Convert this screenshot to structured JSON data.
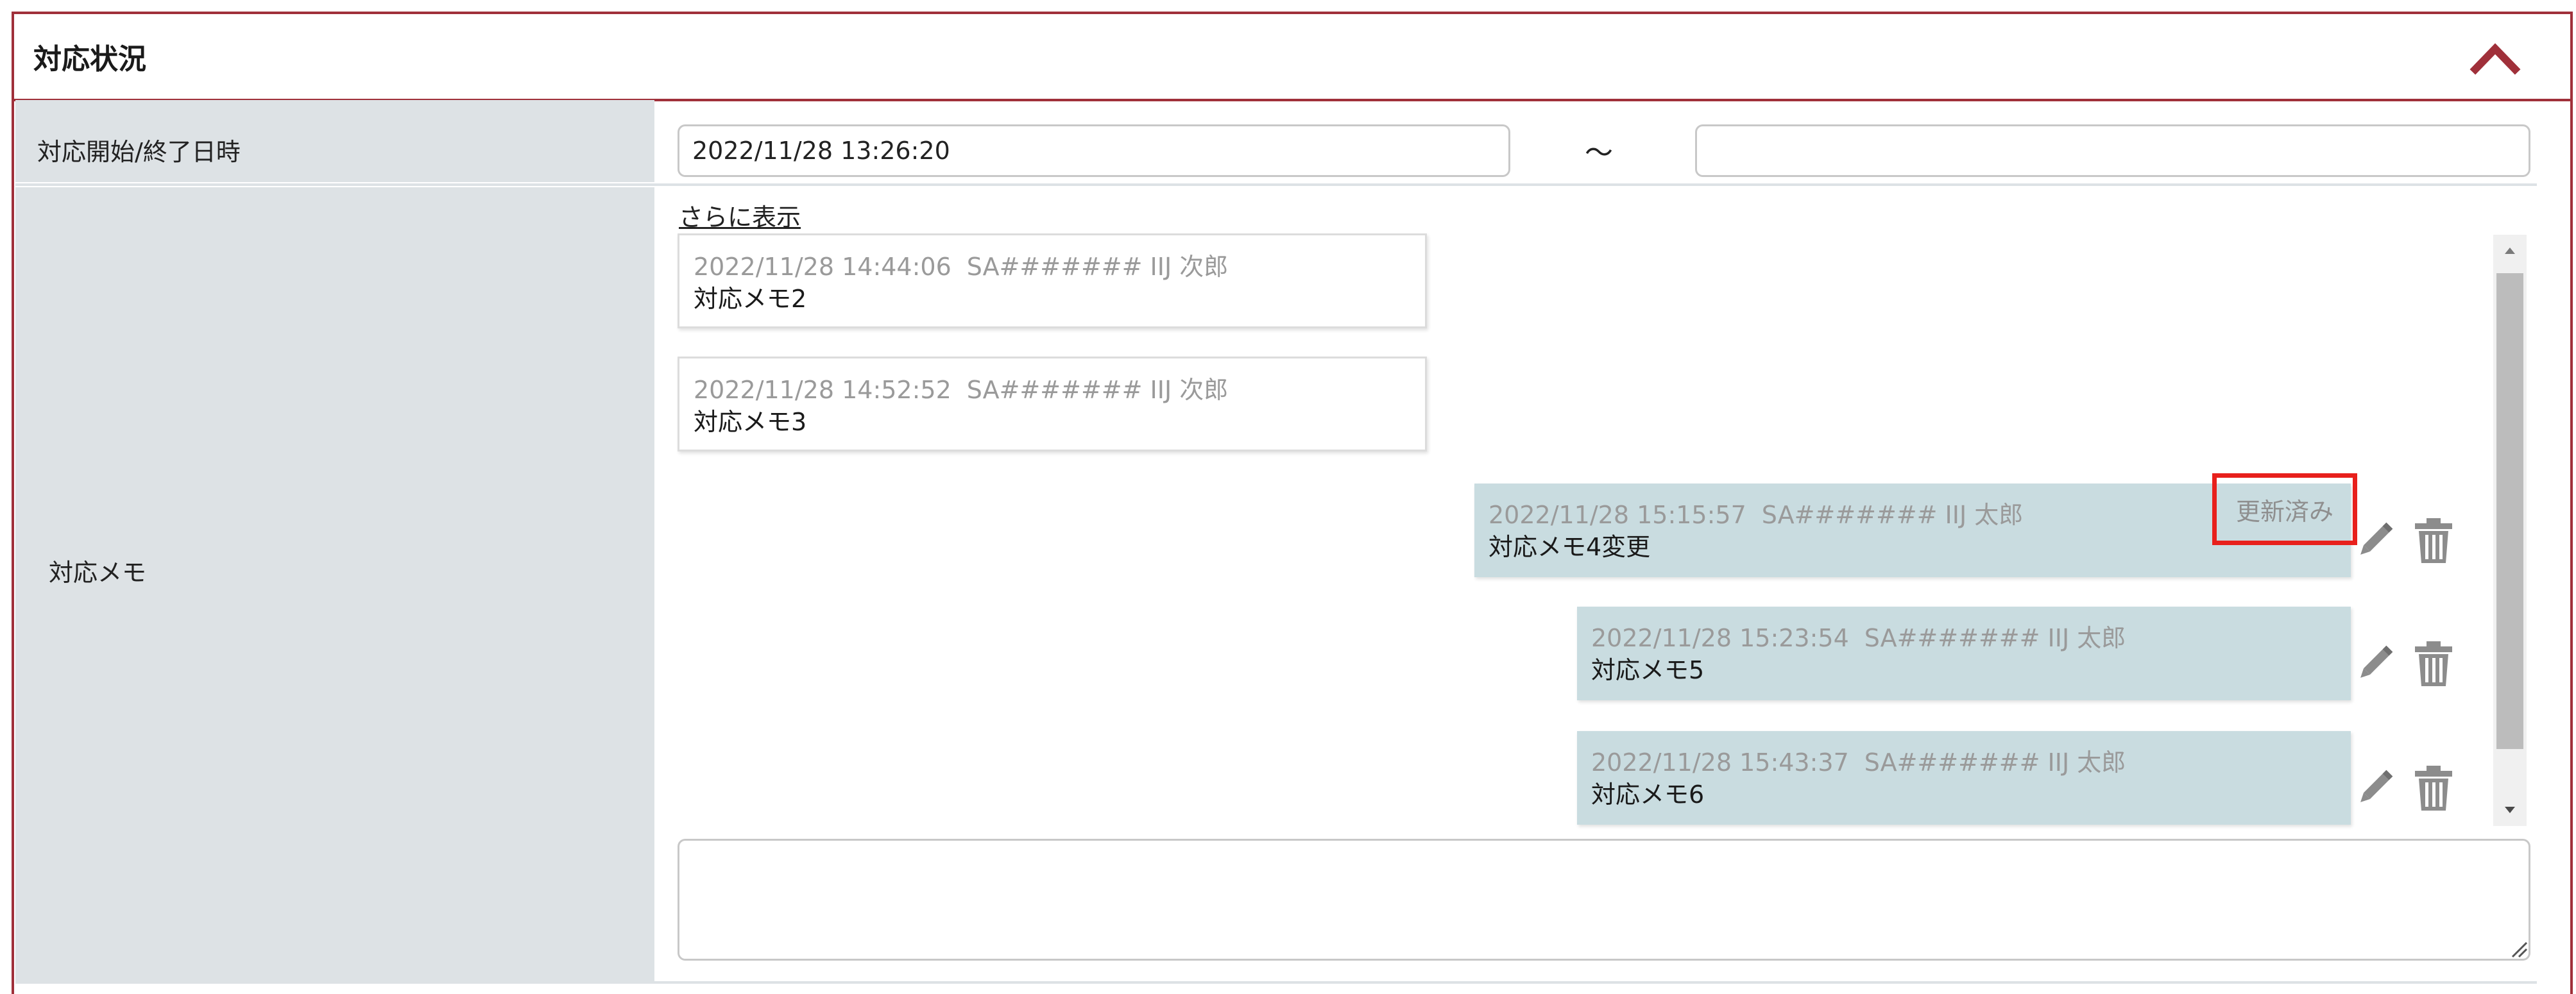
{
  "panel": {
    "title": "対応状況",
    "colors": {
      "border": "#a0303a",
      "label_bg": "#dde2e5",
      "mine_bg": "#c9dce0",
      "highlight": "#e8201c"
    }
  },
  "period": {
    "label": "対応開始/終了日時",
    "start_value": "2022/11/28 13:26:20",
    "separator": "～",
    "end_value": ""
  },
  "memo_section": {
    "label": "対応メモ",
    "more_link": "さらに表示",
    "messages": [
      {
        "timestamp": "2022/11/28 14:44:06",
        "author": "SA####### IIJ 次郎",
        "text": "対応メモ2",
        "own": false
      },
      {
        "timestamp": "2022/11/28 14:52:52",
        "author": "SA####### IIJ 次郎",
        "text": "対応メモ3",
        "own": false
      },
      {
        "timestamp": "2022/11/28 15:15:57",
        "author": "SA####### IIJ 太郎",
        "text": "対応メモ4変更",
        "own": true,
        "status": "更新済み"
      },
      {
        "timestamp": "2022/11/28 15:23:54",
        "author": "SA####### IIJ 太郎",
        "text": "対応メモ5",
        "own": true
      },
      {
        "timestamp": "2022/11/28 15:43:37",
        "author": "SA####### IIJ 太郎",
        "text": "対応メモ6",
        "own": true
      }
    ],
    "input_value": "",
    "icons": {
      "edit": "pencil-icon",
      "delete": "trash-icon",
      "collapse": "chevron-up-icon"
    }
  }
}
